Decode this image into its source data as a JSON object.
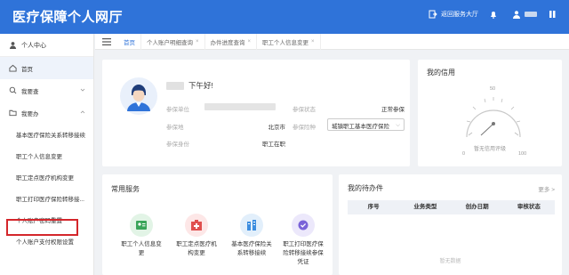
{
  "header": {
    "title": "医疗保障个人网厅",
    "back_label": "返回服务大厅"
  },
  "sidebar": {
    "title": "个人中心",
    "items": [
      {
        "label": "首页"
      },
      {
        "label": "我要查"
      },
      {
        "label": "我要办"
      }
    ],
    "sub_items": [
      {
        "label": "基本医疗保险关系转移接续"
      },
      {
        "label": "职工个人信息变更"
      },
      {
        "label": "职工定点医疗机构变更"
      },
      {
        "label": "职工打印医疗保险转移接..."
      },
      {
        "label": "个人账户密码重置"
      },
      {
        "label": "个人账户支付权限设置"
      }
    ]
  },
  "tabs": [
    {
      "label": "首页"
    },
    {
      "label": "个人账户明细查询"
    },
    {
      "label": "办件进度查询"
    },
    {
      "label": "职工个人信息变更"
    }
  ],
  "profile": {
    "greeting": "下午好!",
    "labels": {
      "unit": "参保单位",
      "region": "参保地",
      "identity": "参保身份",
      "status": "参保状态",
      "insurance_type": "参保险种"
    },
    "values": {
      "region": "北京市",
      "identity": "职工在职",
      "status": "正常参保",
      "insurance_type": "城镇职工基本医疗保险"
    }
  },
  "credit": {
    "title": "我的信用",
    "ticks": [
      "0",
      "50",
      "100"
    ],
    "empty_text": "暂无信用评级"
  },
  "services": {
    "title": "常用服务",
    "items": [
      {
        "line1": "职工个人信息变",
        "line2": "更",
        "line3": ""
      },
      {
        "line1": "职工定点医疗机",
        "line2": "构变更",
        "line3": ""
      },
      {
        "line1": "基本医疗保险关",
        "line2": "系转移接续",
        "line3": ""
      },
      {
        "line1": "职工打印医疗保",
        "line2": "险转移接续参保",
        "line3": "凭证"
      }
    ]
  },
  "todo": {
    "title": "我的待办件",
    "more": "更多 >",
    "columns": [
      "序号",
      "业务类型",
      "创办日期",
      "审核状态"
    ],
    "empty_text": "暂无数据"
  },
  "colors": {
    "brand": "#2f73d9",
    "highlight": "#d4262b"
  }
}
